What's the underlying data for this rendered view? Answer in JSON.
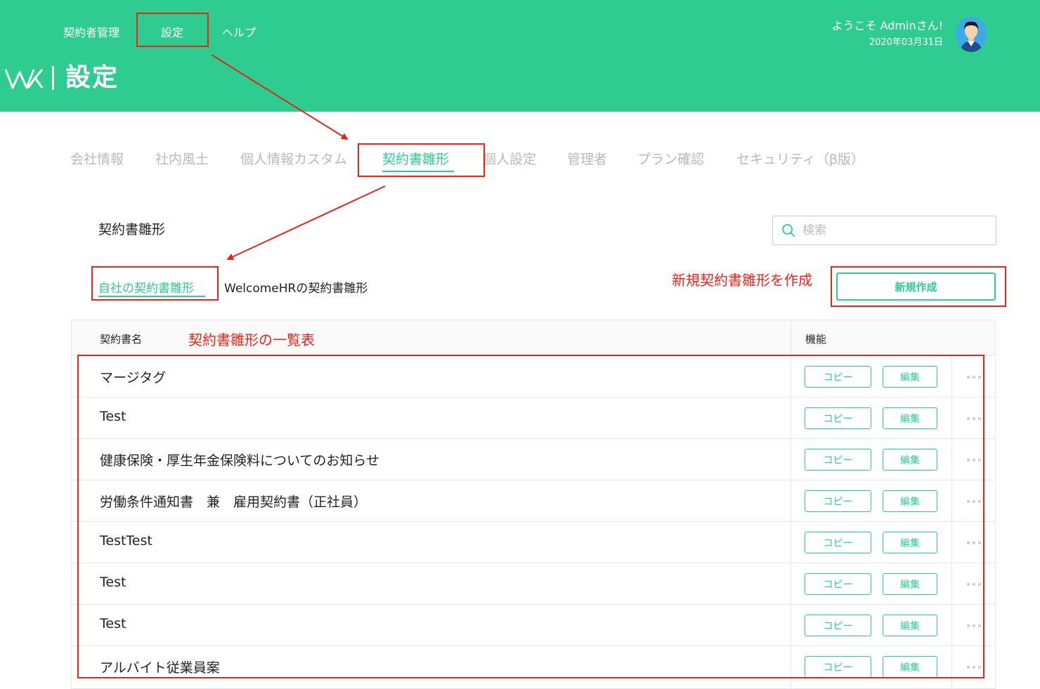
{
  "header": {
    "nav": {
      "contractor_mgmt": "契約者管理",
      "settings": "設定",
      "help": "ヘルプ"
    },
    "title": "設定",
    "welcome": "ようこそ Adminさん!",
    "date": "2020年03月31日"
  },
  "tabs": [
    "会社情報",
    "社内風土",
    "個人情報カスタム",
    "契約書雛形",
    "個人設定",
    "管理者",
    "プラン確認",
    "セキュリティ（β版）"
  ],
  "section": {
    "title": "契約書雛形",
    "search_placeholder": "検索",
    "subtab_own": "自社の契約書雛形",
    "subtab_welcomehr": "WelcomeHRの契約書雛形",
    "create_button": "新規作成"
  },
  "table": {
    "col_name": "契約書名",
    "col_function": "機能",
    "copy_label": "コピー",
    "edit_label": "編集",
    "rows": [
      "マージタグ",
      "Test",
      "健康保険・厚生年金保険料についてのお知らせ",
      "労働条件通知書　兼　雇用契約書（正社員）",
      "TestTest",
      "Test",
      "Test",
      "アルバイト従業員案"
    ]
  },
  "annotations": {
    "create_note": "新規契約書雛形を作成",
    "table_note": "契約書雛形の一覧表"
  },
  "colors": {
    "brand": "#2ecc91",
    "annotation": "#e8241a",
    "muted_tab": "#b9b9b9"
  }
}
